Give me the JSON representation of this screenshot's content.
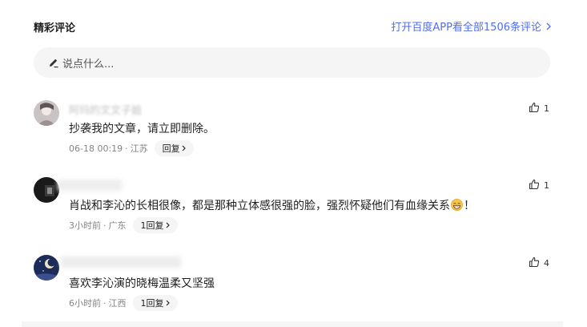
{
  "header": {
    "title": "精彩评论",
    "open_app_link": "打开百度APP看全部1506条评论"
  },
  "comment_input": {
    "placeholder": "说点什么..."
  },
  "comments": [
    {
      "username": "阿玛的文文子姐",
      "text": "抄袭我的文章，请立即删除。",
      "time": "06-18 00:19",
      "location": "江苏",
      "reply_label": "回复",
      "likes": "1"
    },
    {
      "username": "",
      "text_before_emoji": "肖战和李沁的长相很像，都是那种立体感很强的脸，强烈怀疑他们有血缘关系",
      "text_after_emoji": "！",
      "emoji": "grin-emoji",
      "time": "3小时前",
      "location": "广东",
      "reply_label": "1回复",
      "likes": "1"
    },
    {
      "username": "",
      "text": "喜欢李沁演的晓梅温柔又坚强",
      "time": "6小时前",
      "location": "江西",
      "reply_label": "1回复",
      "likes": "4"
    }
  ],
  "colors": {
    "accent": "#4e6ef2",
    "input_bg": "#f5f5f6",
    "meta_text": "#858585"
  }
}
